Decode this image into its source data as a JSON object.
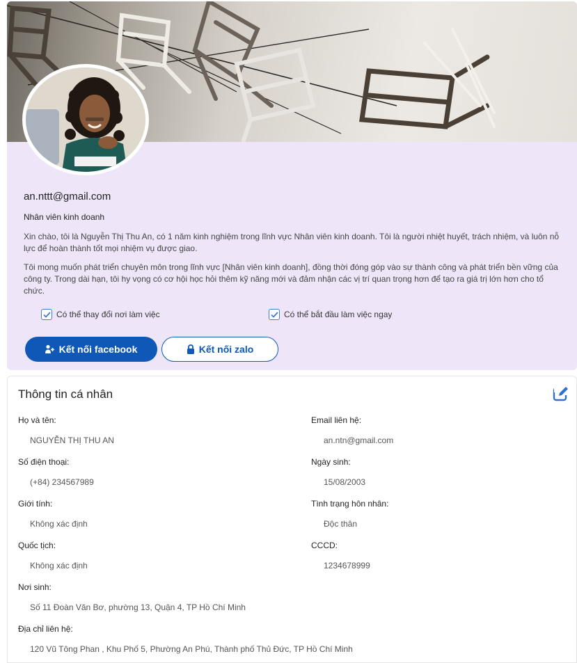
{
  "profile": {
    "email": "an.nttt@gmail.com",
    "job_title": "Nhân viên kinh doanh",
    "bio_paragraph_1": "Xin chào, tôi là Nguyễn Thị Thu An, có 1 năm kinh nghiệm trong lĩnh vực Nhân viên kinh doanh. Tôi là người nhiệt huyết, trách nhiệm, và luôn nỗ lực để hoàn thành tốt mọi nhiệm vụ được giao.",
    "bio_paragraph_2": "Tôi mong muốn phát triển chuyên môn trong lĩnh vực [Nhân viên kinh doanh], đồng thời đóng góp vào sự thành công và phát triển bền vững của công ty. Trong dài hạn, tôi hy vọng có cơ hội học hỏi thêm kỹ năng mới và đảm nhận các vị trí quan trọng hơn để tạo ra giá trị lớn hơn cho tổ chức.",
    "checkboxes": [
      {
        "label": "Có thể thay đổi nơi làm việc",
        "checked": true
      },
      {
        "label": "Có thể bắt đầu làm việc ngay",
        "checked": true
      }
    ],
    "buttons": {
      "facebook": "Kết nối facebook",
      "zalo": "Kết nối zalo"
    }
  },
  "personal_info": {
    "title": "Thông tin cá nhân",
    "fields": {
      "full_name": {
        "label": "Họ và tên:",
        "value": "NGUYỄN THỊ THU AN"
      },
      "contact_email": {
        "label": "Email liên hệ:",
        "value": "an.ntn@gmail.com"
      },
      "phone": {
        "label": "Số điện thoại:",
        "value": "(+84) 234567989"
      },
      "birthday": {
        "label": "Ngày sinh:",
        "value": "15/08/2003"
      },
      "gender": {
        "label": "Giới tính:",
        "value": "Không xác định"
      },
      "marital_status": {
        "label": "Tình trạng hôn nhân:",
        "value": "Độc thân"
      },
      "nationality": {
        "label": "Quốc tịch:",
        "value": "Không xác định"
      },
      "id_card": {
        "label": "CCCD:",
        "value": "1234678999"
      },
      "birthplace": {
        "label": "Nơi sinh:",
        "value": "Số 11 Đoàn Văn Bơ, phường 13, Quận 4, TP Hồ Chí Minh"
      },
      "contact_address": {
        "label": "Địa chỉ liên hệ:",
        "value": "120 Vũ Tông Phan , Khu Phố 5, Phường An Phú, Thành phố Thủ Đức, TP Hồ Chí Minh"
      }
    }
  },
  "colors": {
    "accent": "#0f58b8",
    "card_background": "#eee6f8",
    "checkbox": "#3f7bd8",
    "edit_icon": "#2f6fd0"
  },
  "icons": [
    "person-add-icon",
    "lock-icon",
    "checkbox-checked-icon",
    "edit-icon"
  ]
}
